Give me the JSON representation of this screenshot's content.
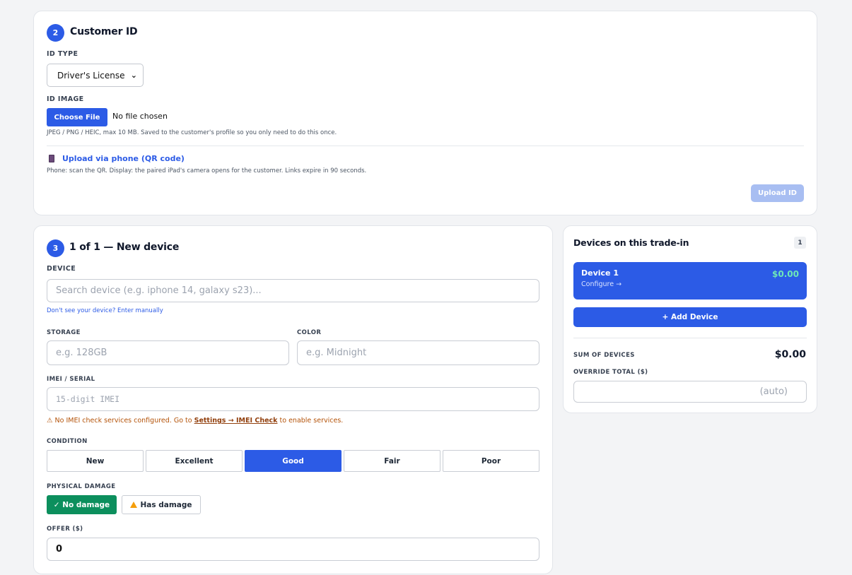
{
  "customer_id": {
    "step": "2",
    "title": "Customer ID",
    "id_type_label": "ID TYPE",
    "id_type_value": "Driver's License",
    "id_image_label": "ID IMAGE",
    "choose_file_label": "Choose File",
    "file_status": "No file chosen",
    "file_hint": "JPEG / PNG / HEIC, max 10 MB. Saved to the customer's profile so you only need to do this once.",
    "qr_link_label": "Upload via phone (QR code)",
    "qr_hint": "Phone: scan the QR. Display: the paired iPad's camera opens for the customer. Links expire in 90 seconds.",
    "upload_button_label": "Upload ID"
  },
  "device_form": {
    "step": "3",
    "title": "1 of 1 — New device",
    "device_label": "DEVICE",
    "device_placeholder": "Search device (e.g. iphone 14, galaxy s23)...",
    "manual_link": "Don't see your device? Enter manually",
    "storage_label": "STORAGE",
    "storage_placeholder": "e.g. 128GB",
    "color_label": "COLOR",
    "color_placeholder": "e.g. Midnight",
    "imei_label": "IMEI / SERIAL",
    "imei_placeholder": "15-digit IMEI",
    "imei_warning_prefix": "⚠ No IMEI check services configured. Go to",
    "imei_warning_link": "Settings → IMEI Check",
    "imei_warning_suffix": "to enable services.",
    "condition_label": "CONDITION",
    "conditions": [
      "New",
      "Excellent",
      "Good",
      "Fair",
      "Poor"
    ],
    "selected_condition": "Good",
    "damage_label": "PHYSICAL DAMAGE",
    "no_damage_label": "✓ No damage",
    "has_damage_label": "Has damage",
    "offer_label": "OFFER ($)",
    "offer_value": "0"
  },
  "devices_panel": {
    "title": "Devices on this trade-in",
    "count": "1",
    "items": [
      {
        "name": "Device 1",
        "sub": "Configure →",
        "price": "$0.00"
      }
    ],
    "add_button_label": "+ Add Device",
    "sum_label": "SUM OF DEVICES",
    "sum_value": "$0.00",
    "override_label": "OVERRIDE TOTAL ($)",
    "override_placeholder": "(auto)"
  },
  "colors": {
    "accent": "#2c5be6",
    "success": "#0c8f5d",
    "warning": "#b45309",
    "price_green": "#6ee7b7"
  },
  "icons": {
    "phone": "phone-icon",
    "warning": "warning-icon",
    "chevron": "chevron-down-icon"
  }
}
